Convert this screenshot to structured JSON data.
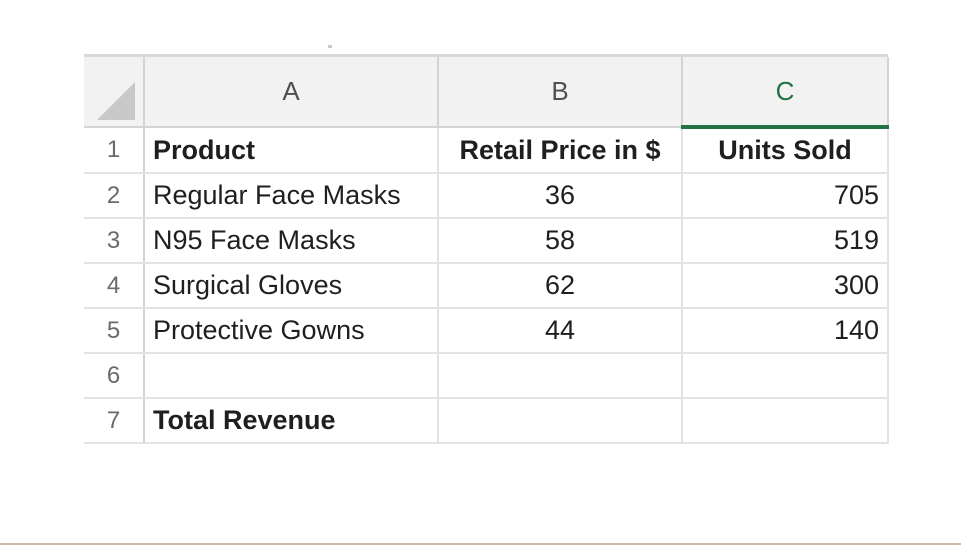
{
  "columns": [
    "A",
    "B",
    "C"
  ],
  "selected_column": "C",
  "rows": [
    {
      "num": "1",
      "a": "Product",
      "b": "Retail Price in $",
      "c": "Units Sold"
    },
    {
      "num": "2",
      "a": "Regular Face Masks",
      "b": "36",
      "c": "705"
    },
    {
      "num": "3",
      "a": "N95 Face Masks",
      "b": "58",
      "c": "519"
    },
    {
      "num": "4",
      "a": "Surgical Gloves",
      "b": "62",
      "c": "300"
    },
    {
      "num": "5",
      "a": "Protective Gowns",
      "b": "44",
      "c": "140"
    },
    {
      "num": "6",
      "a": "",
      "b": "",
      "c": ""
    },
    {
      "num": "7",
      "a": "Total Revenue",
      "b": "",
      "c": ""
    }
  ],
  "colors": {
    "accent": "#217346",
    "header_bg": "#f2f2f2",
    "grid": "#e3e3e3"
  }
}
